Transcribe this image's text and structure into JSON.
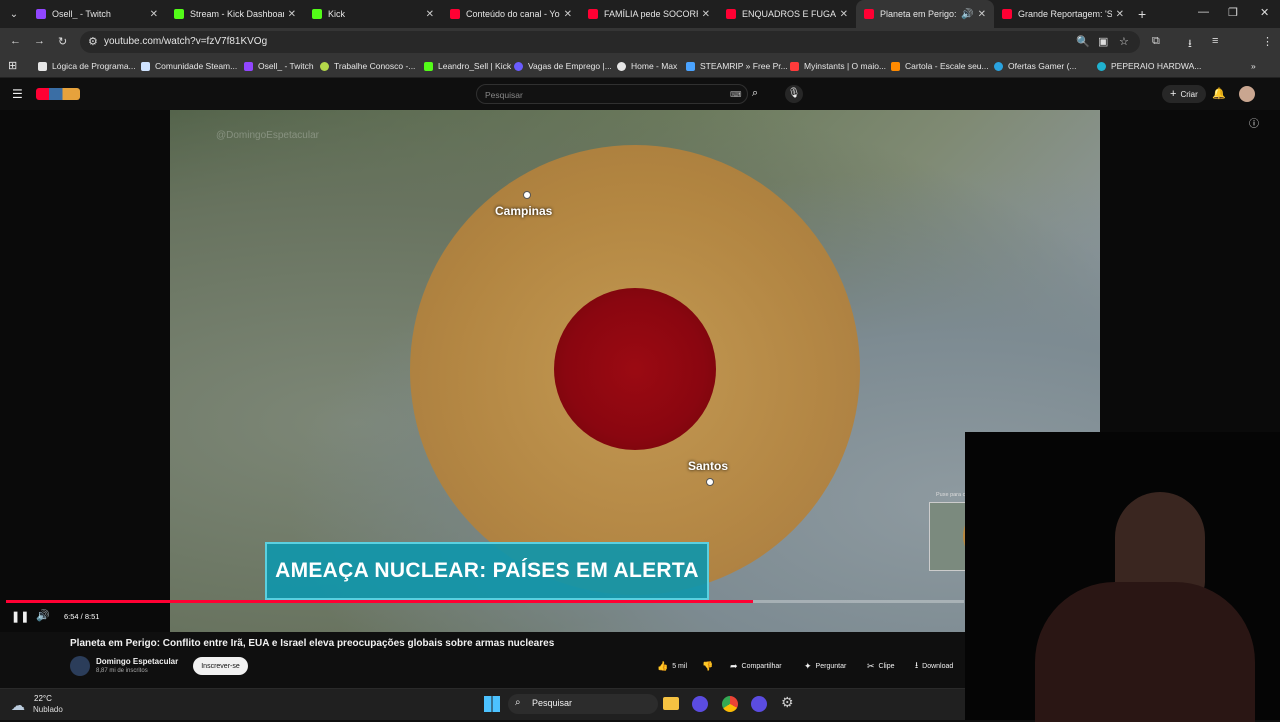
{
  "browser": {
    "tabs": [
      {
        "title": "Osell_ - Twitch",
        "color": "#9146ff"
      },
      {
        "title": "Stream - Kick Dashboard",
        "color": "#53fc18"
      },
      {
        "title": "Kick",
        "color": "#53fc18"
      },
      {
        "title": "Conteúdo do canal - YouT",
        "color": "#ff0033"
      },
      {
        "title": "FAMÍLIA pede SOCORRO",
        "color": "#ff0033"
      },
      {
        "title": "ENQUADROS E FUGAS DE",
        "color": "#ff0033"
      },
      {
        "title": "Planeta em Perigo: C",
        "color": "#ff0033"
      },
      {
        "title": "Grande Reportagem: 'Se",
        "color": "#ff0033"
      }
    ],
    "new_tab": "+",
    "url": "youtube.com/watch?v=fzV7f81KVOg",
    "bookmarks": [
      {
        "label": "Lógica de Programa...",
        "color": "#e6e6e6"
      },
      {
        "label": "Comunidade Steam...",
        "color": "#cfe3ff"
      },
      {
        "label": "Osell_ - Twitch",
        "color": "#9146ff"
      },
      {
        "label": "Trabalhe Conosco -...",
        "color": "#b4d94a"
      },
      {
        "label": "Leandro_Sell | Kick",
        "color": "#53fc18"
      },
      {
        "label": "Vagas de Emprego |...",
        "color": "#6a5cff"
      },
      {
        "label": "Home - Max",
        "color": "#e6e6e6"
      },
      {
        "label": "STEAMRIP » Free Pr...",
        "color": "#4aa3ff"
      },
      {
        "label": "Myinstants | O maio...",
        "color": "#ff3b3b"
      },
      {
        "label": "Cartola - Escale seu...",
        "color": "#ff8a00"
      },
      {
        "label": "Ofertas Gamer (...",
        "color": "#2aa3e0"
      },
      {
        "label": "PEPERAIO HARDWA...",
        "color": "#20b2d0"
      }
    ]
  },
  "youtube": {
    "search_placeholder": "Pesquisar",
    "create_label": "Criar",
    "video": {
      "watermark": "@DomingoEspetacular",
      "city_1": "Campinas",
      "city_2": "Santos",
      "banner": "AMEAÇA NUCLEAR: PAÍSES EM ALERTA",
      "mini_caption": "Puxe para cima para uma busca precisa",
      "time": "6:54 / 8:51",
      "progress": 0.78
    },
    "title": "Planeta em Perigo: Conflito entre Irã, EUA e Israel eleva preocupações globais sobre armas nucleares",
    "channel": {
      "name": "Domingo Espetacular",
      "subs": "8,87 mi de inscritos",
      "subscribe": "Inscrever-se"
    },
    "actions": {
      "like": "5 mil",
      "share": "Compartilhar",
      "ask": "Perguntar",
      "clip": "Clipe",
      "download": "Download"
    }
  },
  "taskbar": {
    "weather_temp": "22°C",
    "weather_desc": "Nublado",
    "search": "Pesquisar"
  }
}
